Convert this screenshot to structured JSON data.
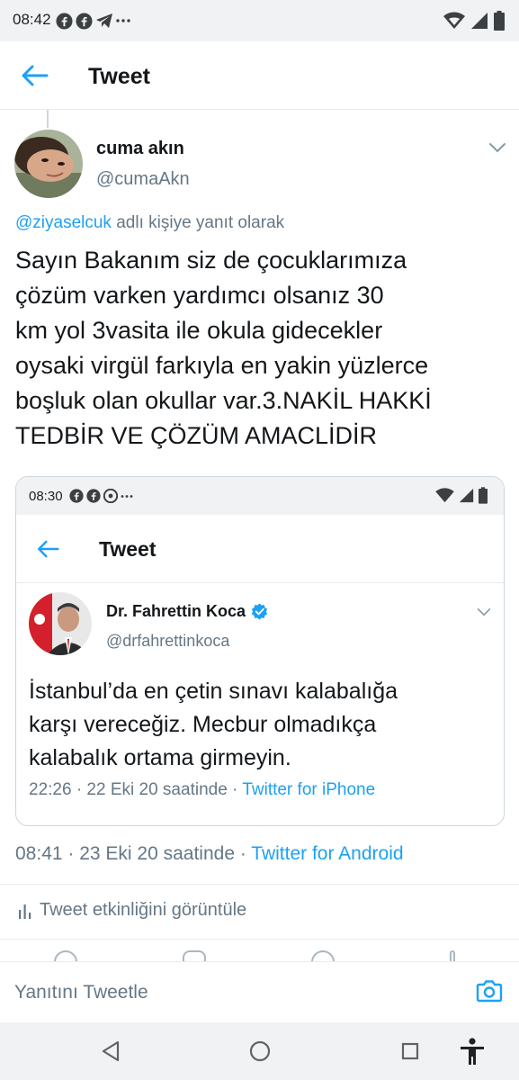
{
  "status_bar": {
    "time": "08:42",
    "notification_icons": [
      "facebook-icon",
      "facebook-icon",
      "telegram-icon",
      "more-dots-icon"
    ],
    "system_icons": [
      "wifi-icon",
      "signal-icon",
      "battery-icon"
    ]
  },
  "app_bar": {
    "title": "Tweet",
    "back_icon": "back-arrow-icon"
  },
  "tweet": {
    "author_name": "cuma akın",
    "author_handle": "@cumaAkn",
    "reply_mention": "@ziyaselcuk",
    "reply_suffix": " adlı kişiye yanıt olarak",
    "text_lines": [
      "Sayın Bakanım siz de çocuklarımıza",
      "çözüm varken yardımcı olsanız 30",
      "km yol 3vasita ile okula gidecekler",
      "oysaki virgül farkıyla en yakin yüzlerce",
      "boşluk olan okullar var.3.NAKİL HAKKİ",
      "TEDBİR VE ÇÖZÜM AMACLİDİR"
    ],
    "meta_time": "08:41 · 23 Eki 20 saatinde · ",
    "meta_source": "Twitter for Android",
    "activity_label": "Tweet etkinliğini görüntüle"
  },
  "quoted_screenshot": {
    "status_time": "08:30",
    "title": "Tweet",
    "author_name": "Dr. Fahrettin Koca",
    "author_handle": "@drfahrettinkoca",
    "verified": true,
    "text_lines": [
      "İstanbul’da en çetin sınavı kalabalığa",
      "karşı vereceğiz. Mecbur olmadıkça",
      "kalabalık ortama girmeyin."
    ],
    "meta_time": "22:26 · 22 Eki 20 saatinde · ",
    "meta_source": "Twitter for iPhone"
  },
  "reply_bar": {
    "placeholder": "Yanıtını Tweetle",
    "camera_icon": "camera-icon"
  },
  "nav_bar": {
    "icons": [
      "nav-back-icon",
      "nav-home-icon",
      "nav-recents-icon",
      "accessibility-icon"
    ]
  },
  "colors": {
    "accent": "#1da1f2",
    "text": "#14171a",
    "secondary": "#657786",
    "border": "#e6ecf0",
    "verified": "#1da1f2"
  }
}
